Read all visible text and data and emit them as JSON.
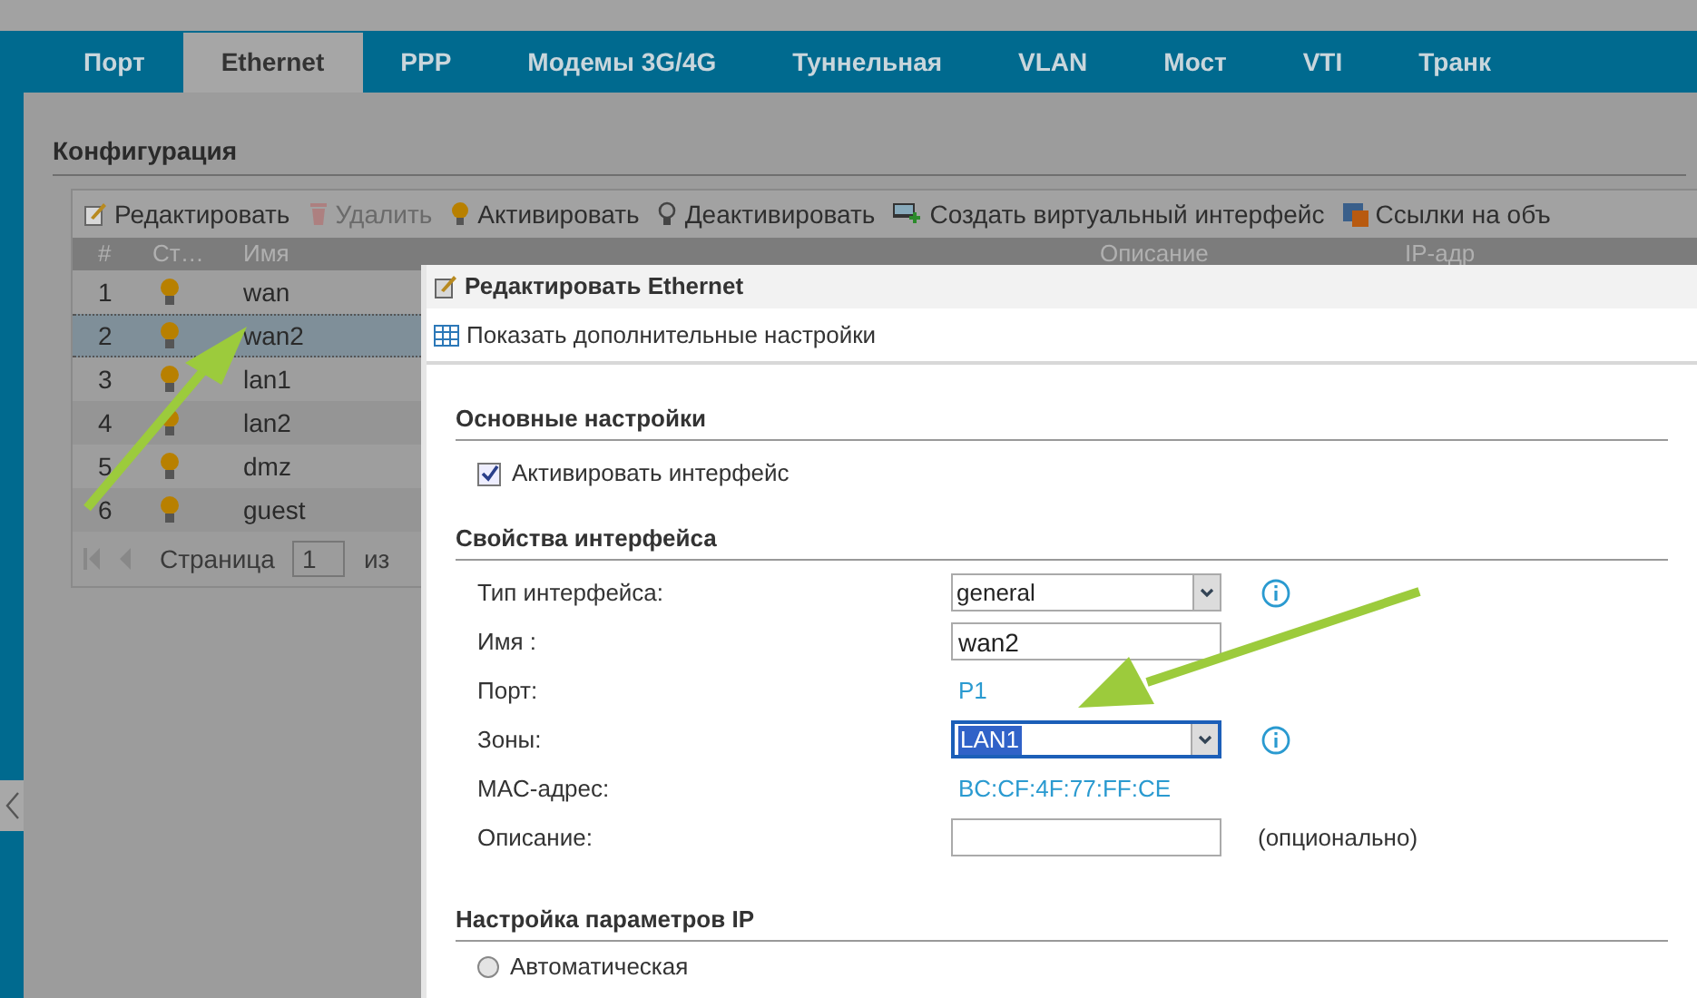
{
  "tabs": [
    {
      "label": "Порт",
      "selected": false
    },
    {
      "label": "Ethernet",
      "selected": true
    },
    {
      "label": "PPP",
      "selected": false
    },
    {
      "label": "Модемы 3G/4G",
      "selected": false
    },
    {
      "label": "Туннельная",
      "selected": false
    },
    {
      "label": "VLAN",
      "selected": false
    },
    {
      "label": "Мост",
      "selected": false
    },
    {
      "label": "VTI",
      "selected": false
    },
    {
      "label": "Транк",
      "selected": false
    }
  ],
  "section_title": "Конфигурация",
  "toolbar": [
    {
      "label": "Редактировать",
      "disabled": false
    },
    {
      "label": "Удалить",
      "disabled": true
    },
    {
      "label": "Активировать",
      "disabled": false
    },
    {
      "label": "Деактивировать",
      "disabled": false
    },
    {
      "label": "Создать виртуальный интерфейс",
      "disabled": false
    },
    {
      "label": "Ссылки на объ",
      "disabled": false
    }
  ],
  "table": {
    "columns": [
      "#",
      "Ст…",
      "Имя",
      "Описание",
      "IP-адр"
    ],
    "rows": [
      {
        "number": "1",
        "active": true,
        "name": "wan",
        "selected": false
      },
      {
        "number": "2",
        "active": true,
        "name": "wan2",
        "selected": true
      },
      {
        "number": "3",
        "active": true,
        "name": "lan1",
        "selected": false
      },
      {
        "number": "4",
        "active": true,
        "name": "lan2",
        "selected": false
      },
      {
        "number": "5",
        "active": true,
        "name": "dmz",
        "selected": false
      },
      {
        "number": "6",
        "active": true,
        "name": "guest",
        "selected": false
      }
    ],
    "pager": {
      "label": "Страница",
      "page": "1",
      "of": "из"
    }
  },
  "dialog": {
    "title": "Редактировать Ethernet",
    "link": "Показать дополнительные настройки",
    "basic": {
      "title": "Основные настройки",
      "checkbox": {
        "label": "Активировать интерфейс",
        "checked": true
      }
    },
    "properties": {
      "title": "Свойства интерфейса",
      "fields": [
        {
          "kind": "select",
          "label": "Тип интерфейса:",
          "value": "general",
          "focused": false
        },
        {
          "kind": "input",
          "label": "Имя :",
          "value": "wan2"
        },
        {
          "kind": "text",
          "label": "Порт:",
          "value": "P1"
        },
        {
          "kind": "select",
          "label": "Зоны:",
          "value": "LAN1",
          "focused": true
        },
        {
          "kind": "text",
          "label": "MAC-адрес:",
          "value": "BC:CF:4F:77:FF:CE"
        },
        {
          "kind": "input",
          "label": "Описание:",
          "hint": "(опционально)"
        }
      ]
    },
    "ip": {
      "title": "Настройка параметров IP",
      "radio": {
        "label": "Автоматическая",
        "selected": false
      }
    }
  }
}
